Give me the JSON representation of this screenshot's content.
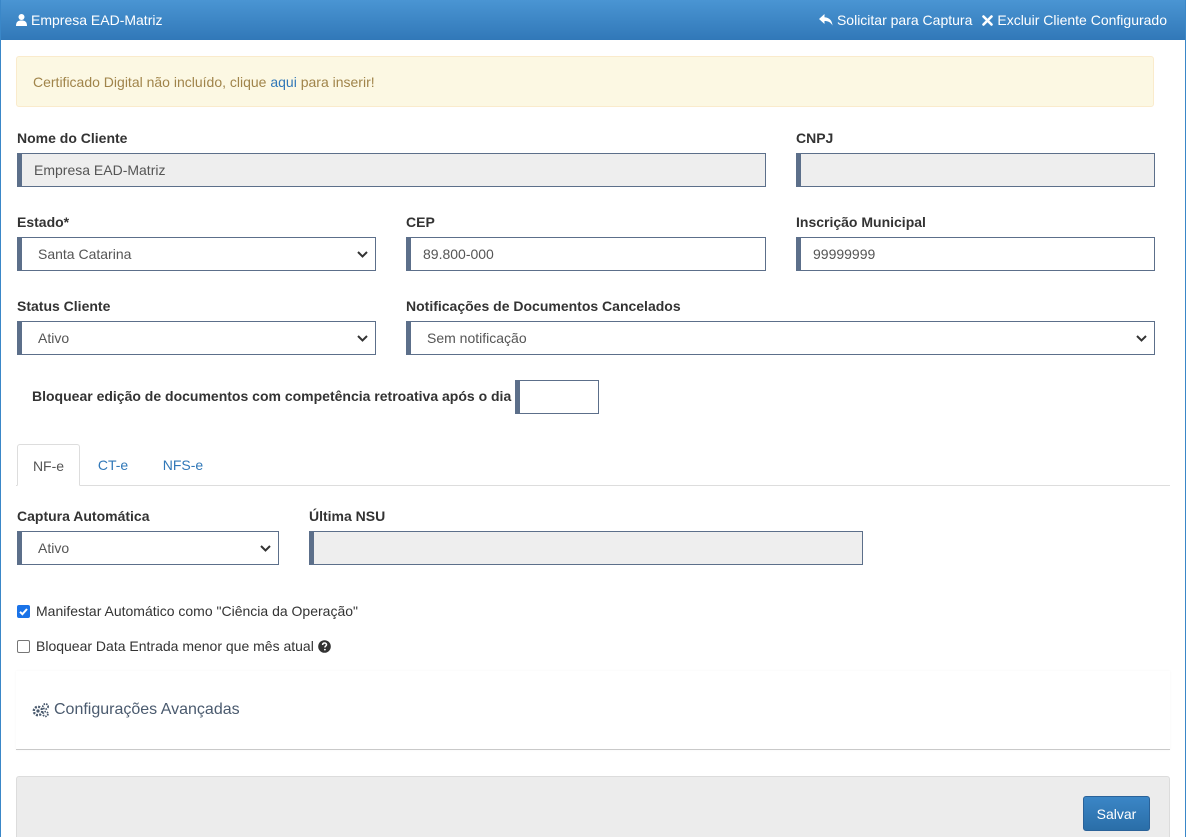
{
  "header": {
    "title": "Empresa EAD-Matriz",
    "action_capture": "Solicitar para Captura",
    "action_delete": "Excluir Cliente Configurado"
  },
  "alert": {
    "text_before": "Certificado Digital não incluído, clique ",
    "link": "aqui",
    "text_after": " para inserir!"
  },
  "form": {
    "client_name_label": "Nome do Cliente",
    "client_name_value": "Empresa EAD-Matriz",
    "cnpj_label": "CNPJ",
    "cnpj_value": "",
    "state_label": "Estado*",
    "state_value": "Santa Catarina",
    "cep_label": "CEP",
    "cep_value": "89.800-000",
    "municipal_label": "Inscrição Municipal",
    "municipal_value": "99999999",
    "status_label": "Status Cliente",
    "status_value": "Ativo",
    "notif_label": "Notificações de Documentos Cancelados",
    "notif_value": "Sem notificação",
    "block_label": "Bloquear edição de documentos com competência retroativa após o dia",
    "block_value": ""
  },
  "tabs": [
    {
      "label": "NF-e",
      "active": true
    },
    {
      "label": "CT-e",
      "active": false
    },
    {
      "label": "NFS-e",
      "active": false
    }
  ],
  "nfe": {
    "capture_label": "Captura Automática",
    "capture_value": "Ativo",
    "nsu_label": "Última NSU",
    "nsu_value": "",
    "manifest_label": "Manifestar Automático como \"Ciência da Operação\"",
    "manifest_checked": true,
    "block_date_label": "Bloquear Data Entrada menor que mês atual",
    "block_date_checked": false
  },
  "advanced": {
    "title": "Configurações Avançadas"
  },
  "footer": {
    "save_label": "Salvar"
  },
  "colors": {
    "header": "#3178b8",
    "alert_bg": "#fcf8e3",
    "alert_text": "#a0844a",
    "field_accent": "#5c6f8a",
    "save_button": "#2a6ea8"
  },
  "icons": [
    "user-icon",
    "reply-icon",
    "close-icon",
    "chevron-down-icon",
    "question-circle-icon",
    "cogs-icon",
    "checkmark-icon"
  ]
}
